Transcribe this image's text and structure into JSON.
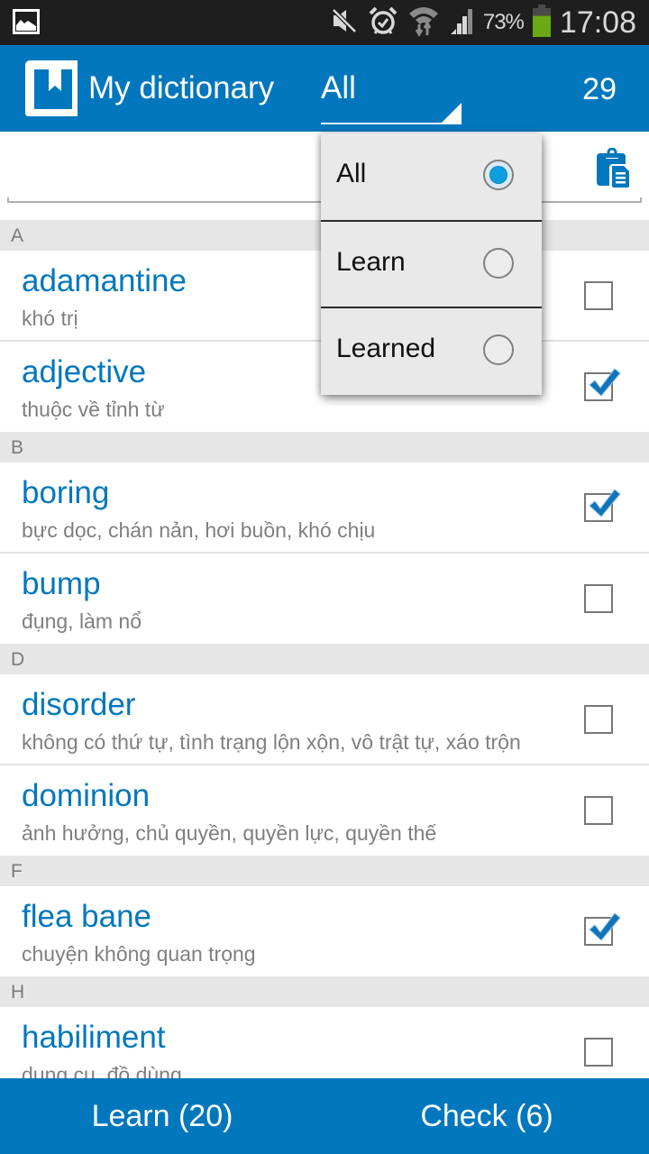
{
  "status_bar": {
    "left_icon": "image-notification-icon",
    "icons": [
      "mute-icon",
      "alarm-icon",
      "wifi-icon",
      "signal-icon"
    ],
    "battery_percent": "73%",
    "battery_level": 0.73,
    "battery_color": "#6aa815",
    "time": "17:08"
  },
  "app_bar": {
    "logo_icon": "book-bookmark-icon",
    "title": "My dictionary",
    "filter_value": "All",
    "word_count": "29",
    "color": "#0277bd"
  },
  "search": {
    "value": "",
    "placeholder": "",
    "paste_icon": "clipboard-icon"
  },
  "filter_menu": {
    "items": [
      {
        "label": "All",
        "selected": true
      },
      {
        "label": "Learn",
        "selected": false
      },
      {
        "label": "Learned",
        "selected": false
      }
    ]
  },
  "sections": [
    {
      "letter": "A",
      "words": [
        {
          "word": "adamantine",
          "meaning": "khó trị",
          "learned": false
        },
        {
          "word": "adjective",
          "meaning": "thuộc về tỉnh từ",
          "learned": true
        }
      ]
    },
    {
      "letter": "B",
      "words": [
        {
          "word": "boring",
          "meaning": "bực dọc, chán nản, hơi buồn, khó chịu",
          "learned": true
        },
        {
          "word": "bump",
          "meaning": "đụng, làm nổ",
          "learned": false
        }
      ]
    },
    {
      "letter": "D",
      "words": [
        {
          "word": "disorder",
          "meaning": "không có thứ tự, tình trạng lộn xộn, vô trật tự, xáo trộn",
          "learned": false
        },
        {
          "word": "dominion",
          "meaning": "ảnh hưởng, chủ quyền, quyền lực, quyền thế",
          "learned": false
        }
      ]
    },
    {
      "letter": "F",
      "words": [
        {
          "word": "flea bane",
          "meaning": "chuyện không quan trọng",
          "learned": true
        }
      ]
    },
    {
      "letter": "H",
      "words": [
        {
          "word": "habiliment",
          "meaning": "dụng cụ, đồ dùng",
          "learned": false
        }
      ]
    }
  ],
  "bottom_bar": {
    "learn_label": "Learn (20)",
    "check_label": "Check (6)"
  }
}
